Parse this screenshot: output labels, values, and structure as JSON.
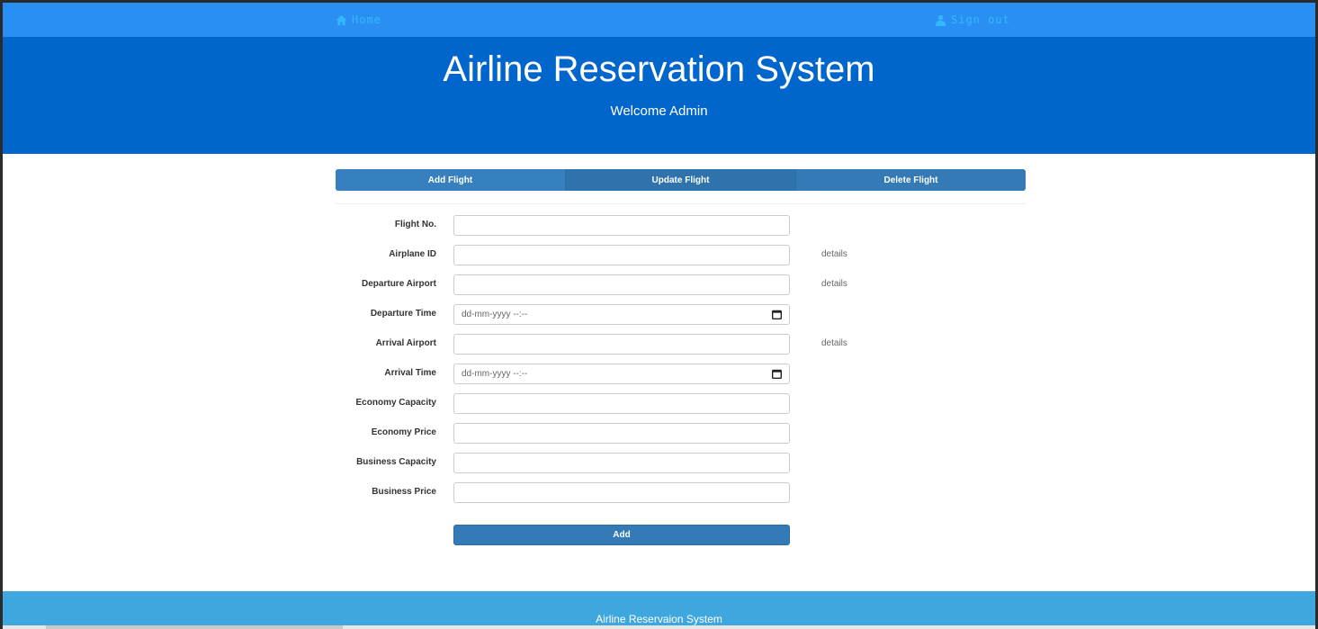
{
  "nav": {
    "home_label": "Home",
    "signout_label": "Sign out"
  },
  "header": {
    "title": "Airline Reservation System",
    "welcome": "Welcome Admin"
  },
  "tabs": [
    "Add Flight",
    "Update Flight",
    "Delete Flight"
  ],
  "form": {
    "fields": [
      {
        "label": "Flight No.",
        "value": ""
      },
      {
        "label": "Airplane ID",
        "value": "",
        "details": "details"
      },
      {
        "label": "Departure Airport",
        "value": "",
        "details": "details"
      },
      {
        "label": "Departure Time",
        "placeholder": "dd-mm-yyyy --:--"
      },
      {
        "label": "Arrival Airport",
        "value": "",
        "details": "details"
      },
      {
        "label": "Arrival Time",
        "placeholder": "dd-mm-yyyy --:--"
      },
      {
        "label": "Economy Capacity",
        "value": ""
      },
      {
        "label": "Economy Price",
        "value": ""
      },
      {
        "label": "Business Capacity",
        "value": ""
      },
      {
        "label": "Business Price",
        "value": ""
      }
    ],
    "submit_label": "Add"
  },
  "footer": {
    "text": "Airline Reservaion System"
  },
  "colors": {
    "nav_bg": "#2a8ff2",
    "hero_bg": "#0066cc",
    "button_bg": "#337ab7",
    "footer_bg": "#3ea8de"
  }
}
